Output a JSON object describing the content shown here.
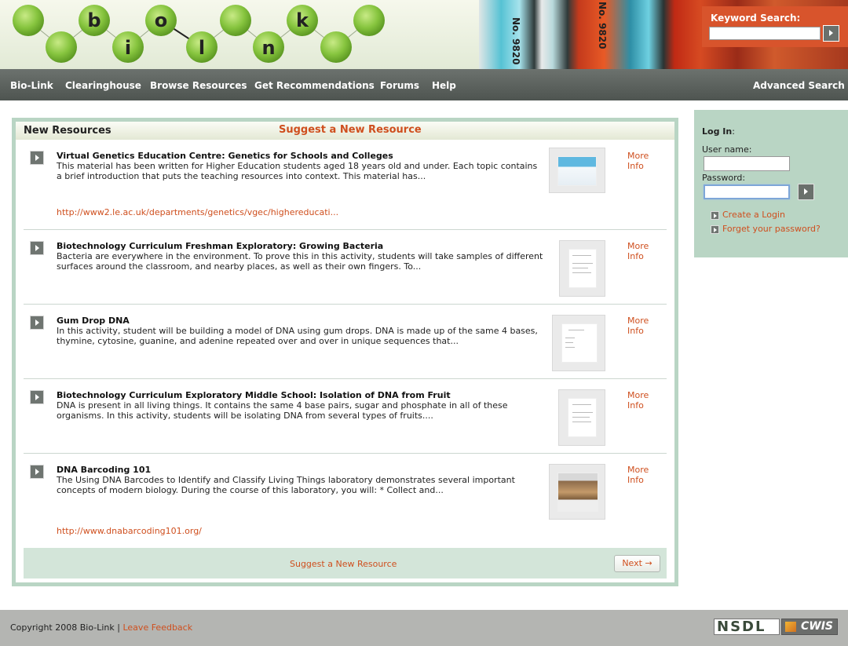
{
  "header": {
    "logo_letters": [
      "b",
      "o",
      "k",
      "i",
      "l",
      "n"
    ],
    "tube_labels": [
      "No. 9820",
      "No. 9820"
    ],
    "keyword_search_label": "Keyword Search:"
  },
  "nav": {
    "items": [
      "Bio-Link",
      "Clearinghouse",
      "Browse Resources",
      "Get Recommendations",
      "Forums",
      "Help"
    ],
    "advanced_search": "Advanced Search"
  },
  "panel": {
    "title": "New Resources",
    "suggest_link": "Suggest a New Resource",
    "more_info_label": "More Info",
    "resources": [
      {
        "title": "Virtual Genetics Education Centre: Genetics for Schools and Colleges",
        "description": "This material has been written for Higher Education students aged 18 years old and under. Each topic contains a brief introduction that puts the teaching resources into context. This material has...",
        "url": "http://www2.le.ac.uk/departments/genetics/vgec/highereducati..."
      },
      {
        "title": "Biotechnology Curriculum Freshman Exploratory: Growing Bacteria",
        "description": "Bacteria are everywhere in the environment. To prove this in this activity, students will take samples of different surfaces around the classroom, and nearby places, as well as their own fingers. To...",
        "url": ""
      },
      {
        "title": "Gum Drop DNA",
        "description": "In this activity, student will be building a model of DNA using gum drops. DNA is made up of the same 4 bases, thymine, cytosine, guanine, and adenine repeated over and over in unique sequences that...",
        "url": ""
      },
      {
        "title": "Biotechnology Curriculum Exploratory Middle School: Isolation of DNA from Fruit",
        "description": "DNA is present in all living things. It contains the same 4 base pairs, sugar and phosphate in all of these organisms. In this activity, students will be isolating DNA from several types of fruits....",
        "url": ""
      },
      {
        "title": "DNA Barcoding 101",
        "description": "The Using DNA Barcodes to Identify and Classify Living Things laboratory demonstrates several important concepts of modern biology. During the course of this laboratory, you will: * Collect and...",
        "url": "http://www.dnabarcoding101.org/"
      }
    ],
    "footer_suggest": "Suggest a New Resource",
    "next_label": "Next →"
  },
  "login": {
    "title": "Log In",
    "title_suffix": ":",
    "username_label": "User name:",
    "password_label": "Password:",
    "create_login": "Create a Login",
    "forgot_password": "Forget your password?"
  },
  "footer": {
    "copyright": "Copyright 2008 Bio-Link |",
    "feedback": "Leave Feedback",
    "nsdl_logo": "NSDL",
    "cwis_logo": "CWIS"
  }
}
